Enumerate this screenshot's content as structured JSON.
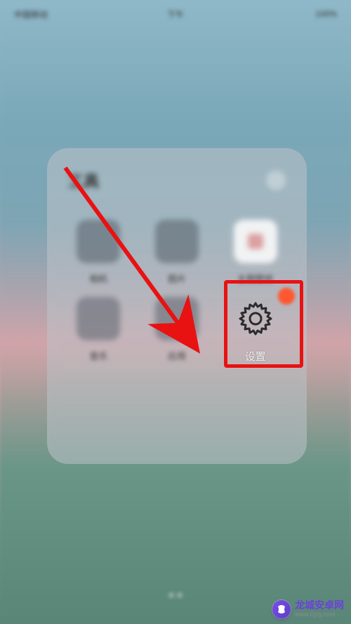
{
  "status": {
    "carrier": "中国移动",
    "time": "下午",
    "battery": "100%"
  },
  "folder": {
    "title": "工具",
    "apps": [
      {
        "label": "相机"
      },
      {
        "label": "图片"
      },
      {
        "label": "主题壁纸"
      },
      {
        "label": "音乐"
      },
      {
        "label": "应用"
      },
      {
        "label": "设置"
      }
    ]
  },
  "highlight": {
    "target": "settings-app",
    "color": "#e81212"
  },
  "watermark": {
    "main": "龙城安卓网",
    "sub": "www.lcjrg.com"
  }
}
